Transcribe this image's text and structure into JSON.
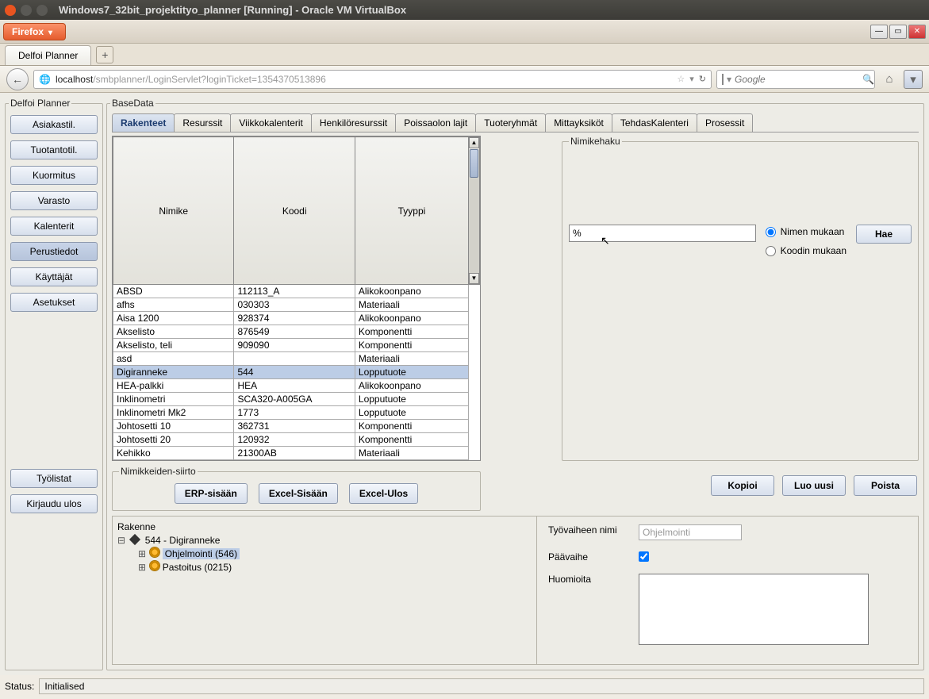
{
  "host": {
    "title": "Windows7_32bit_projektityo_planner [Running] - Oracle VM VirtualBox"
  },
  "firefox": {
    "menu_label": "Firefox",
    "tab_title": "Delfoi Planner",
    "url_host": "localhost",
    "url_path": "/smbplanner/LoginServlet?loginTicket=1354370513896",
    "search_placeholder": "Google"
  },
  "sidebar": {
    "legend": "Delfoi Planner",
    "items": [
      {
        "label": "Asiakastil."
      },
      {
        "label": "Tuotantotil."
      },
      {
        "label": "Kuormitus"
      },
      {
        "label": "Varasto"
      },
      {
        "label": "Kalenterit"
      },
      {
        "label": "Perustiedot"
      },
      {
        "label": "Käyttäjät"
      },
      {
        "label": "Asetukset"
      }
    ],
    "bottom": [
      {
        "label": "Työlistat"
      },
      {
        "label": "Kirjaudu ulos"
      }
    ]
  },
  "main": {
    "legend": "BaseData",
    "tabs": [
      {
        "label": "Rakenteet"
      },
      {
        "label": "Resurssit"
      },
      {
        "label": "Viikkokalenterit"
      },
      {
        "label": "Henkilöresurssit"
      },
      {
        "label": "Poissaolon lajit"
      },
      {
        "label": "Tuoteryhmät"
      },
      {
        "label": "Mittayksiköt"
      },
      {
        "label": "TehdasKalenteri"
      },
      {
        "label": "Prosessit"
      }
    ],
    "columns": {
      "c0": "Nimike",
      "c1": "Koodi",
      "c2": "Tyyppi"
    },
    "rows": [
      {
        "n": "ABSD",
        "k": "112113_A",
        "t": "Alikokoonpano"
      },
      {
        "n": "afhs",
        "k": "030303",
        "t": "Materiaali"
      },
      {
        "n": "Aisa 1200",
        "k": "928374",
        "t": "Alikokoonpano"
      },
      {
        "n": "Akselisto",
        "k": "876549",
        "t": "Komponentti"
      },
      {
        "n": "Akselisto, teli",
        "k": "909090",
        "t": "Komponentti"
      },
      {
        "n": "asd",
        "k": "",
        "t": "Materiaali"
      },
      {
        "n": "Digiranneke",
        "k": "544",
        "t": "Lopputuote"
      },
      {
        "n": "HEA-palkki",
        "k": "HEA",
        "t": "Alikokoonpano"
      },
      {
        "n": "Inklinometri",
        "k": "SCA320-A005GA",
        "t": "Lopputuote"
      },
      {
        "n": "Inklinometri Mk2",
        "k": "1773",
        "t": "Lopputuote"
      },
      {
        "n": "Johtosetti 10",
        "k": "362731",
        "t": "Komponentti"
      },
      {
        "n": "Johtosetti 20",
        "k": "120932",
        "t": "Komponentti"
      },
      {
        "n": "Kehikko",
        "k": "21300AB",
        "t": "Materiaali"
      }
    ],
    "selected_row": 6,
    "siirto_legend": "Nimikkeiden-siirto",
    "siirto": {
      "erp": "ERP-sisään",
      "excel_in": "Excel-Sisään",
      "excel_out": "Excel-Ulos"
    },
    "search_legend": "Nimikehaku",
    "search_value": "%",
    "radio_name": "Nimen mukaan",
    "radio_code": "Koodin mukaan",
    "hae_label": "Hae",
    "actions": {
      "kopioi": "Kopioi",
      "luo": "Luo uusi",
      "poista": "Poista"
    }
  },
  "tree": {
    "header": "Rakenne",
    "root": "544 - Digiranneke",
    "children": [
      {
        "label": "Ohjelmointi (546)",
        "selected": true
      },
      {
        "label": "Pastoitus (0215)",
        "selected": false
      }
    ]
  },
  "detail": {
    "l_name": "Työvaiheen nimi",
    "v_name": "Ohjelmointi",
    "l_main": "Päävaihe",
    "v_main_checked": true,
    "l_notes": "Huomioita"
  },
  "status": {
    "label": "Status:",
    "value": "Initialised"
  }
}
